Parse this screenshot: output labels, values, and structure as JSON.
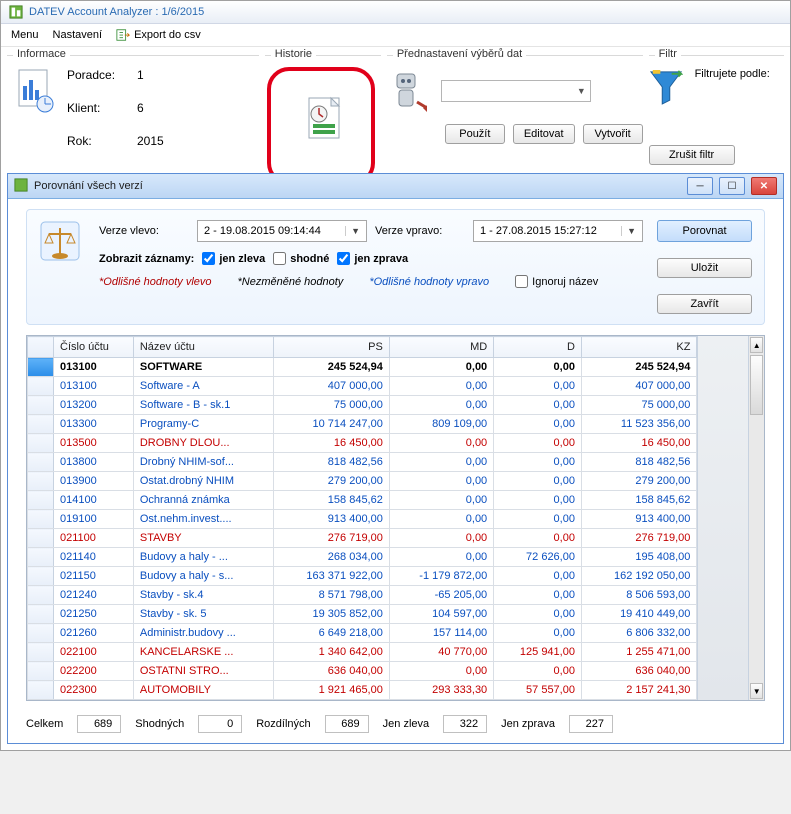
{
  "app": {
    "title": "DATEV Account Analyzer : 1/6/2015"
  },
  "menu": {
    "menu": "Menu",
    "settings": "Nastavení",
    "export": "Export do csv"
  },
  "panels": {
    "informace": {
      "title": "Informace",
      "poradce_lbl": "Poradce:",
      "poradce_val": "1",
      "klient_lbl": "Klient:",
      "klient_val": "6",
      "rok_lbl": "Rok:",
      "rok_val": "2015"
    },
    "historie": {
      "title": "Historie"
    },
    "prednast": {
      "title": "Přednastavení výběrů dat",
      "pouzit": "Použít",
      "editovat": "Editovat",
      "vytvorit": "Vytvořit"
    },
    "filtr": {
      "title": "Filtr",
      "podle": "Filtrujete podle:",
      "zrusit": "Zrušit filtr"
    }
  },
  "compare": {
    "title": "Porovnání všech verzí",
    "verze_vlevo_lbl": "Verze vlevo:",
    "verze_vlevo_val": "2 - 19.08.2015 09:14:44",
    "verze_vpravo_lbl": "Verze vpravo:",
    "verze_vpravo_val": "1 - 27.08.2015 15:27:12",
    "porovnat": "Porovnat",
    "ulozit": "Uložit",
    "zavrit": "Zavřít",
    "zobrazit_lbl": "Zobrazit záznamy:",
    "jen_zleva": "jen zleva",
    "shodne": "shodné",
    "jen_zprava": "jen zprava",
    "legend_left": "*Odlišné hodnoty vlevo",
    "legend_mid": "*Nezměněné hodnoty",
    "legend_right": "*Odlišné hodnoty vpravo",
    "ignoruj": "Ignoruj název"
  },
  "grid": {
    "headers": {
      "cislo": "Číslo účtu",
      "nazev": "Název účtu",
      "ps": "PS",
      "md": "MD",
      "d": "D",
      "kz": "KZ"
    },
    "rows": [
      {
        "c": "013100",
        "n": "SOFTWARE",
        "ps": "245 524,94",
        "md": "0,00",
        "d": "0,00",
        "kz": "245 524,94",
        "cls": "bold",
        "selected": true
      },
      {
        "c": "013100",
        "n": "Software - A",
        "ps": "407 000,00",
        "md": "0,00",
        "d": "0,00",
        "kz": "407 000,00",
        "cls": "blue"
      },
      {
        "c": "013200",
        "n": "Software - B - sk.1",
        "ps": "75 000,00",
        "md": "0,00",
        "d": "0,00",
        "kz": "75 000,00",
        "cls": "blue"
      },
      {
        "c": "013300",
        "n": "Programy-C",
        "ps": "10 714 247,00",
        "md": "809 109,00",
        "d": "0,00",
        "kz": "11 523 356,00",
        "cls": "blue"
      },
      {
        "c": "013500",
        "n": "DROBNY DLOU...",
        "ps": "16 450,00",
        "md": "0,00",
        "d": "0,00",
        "kz": "16 450,00",
        "cls": "red"
      },
      {
        "c": "013800",
        "n": "Drobný NHIM-sof...",
        "ps": "818 482,56",
        "md": "0,00",
        "d": "0,00",
        "kz": "818 482,56",
        "cls": "blue"
      },
      {
        "c": "013900",
        "n": "Ostat.drobný NHIM",
        "ps": "279 200,00",
        "md": "0,00",
        "d": "0,00",
        "kz": "279 200,00",
        "cls": "blue"
      },
      {
        "c": "014100",
        "n": "Ochranná známka",
        "ps": "158 845,62",
        "md": "0,00",
        "d": "0,00",
        "kz": "158 845,62",
        "cls": "blue"
      },
      {
        "c": "019100",
        "n": "Ost.nehm.invest....",
        "ps": "913 400,00",
        "md": "0,00",
        "d": "0,00",
        "kz": "913 400,00",
        "cls": "blue"
      },
      {
        "c": "021100",
        "n": "STAVBY",
        "ps": "276 719,00",
        "md": "0,00",
        "d": "0,00",
        "kz": "276 719,00",
        "cls": "red"
      },
      {
        "c": "021140",
        "n": "Budovy a haly  - ...",
        "ps": "268 034,00",
        "md": "0,00",
        "d": "72 626,00",
        "kz": "195 408,00",
        "cls": "blue"
      },
      {
        "c": "021150",
        "n": "Budovy a haly - s...",
        "ps": "163 371 922,00",
        "md": "-1 179 872,00",
        "d": "0,00",
        "kz": "162 192 050,00",
        "cls": "blue"
      },
      {
        "c": "021240",
        "n": "Stavby  - sk.4",
        "ps": "8 571 798,00",
        "md": "-65 205,00",
        "d": "0,00",
        "kz": "8 506 593,00",
        "cls": "blue"
      },
      {
        "c": "021250",
        "n": "Stavby - sk. 5",
        "ps": "19 305 852,00",
        "md": "104 597,00",
        "d": "0,00",
        "kz": "19 410 449,00",
        "cls": "blue"
      },
      {
        "c": "021260",
        "n": "Administr.budovy ...",
        "ps": "6 649 218,00",
        "md": "157 114,00",
        "d": "0,00",
        "kz": "6 806 332,00",
        "cls": "blue"
      },
      {
        "c": "022100",
        "n": "KANCELARSKE ...",
        "ps": "1 340 642,00",
        "md": "40 770,00",
        "d": "125 941,00",
        "kz": "1 255 471,00",
        "cls": "red"
      },
      {
        "c": "022200",
        "n": "OSTATNI STRO...",
        "ps": "636 040,00",
        "md": "0,00",
        "d": "0,00",
        "kz": "636 040,00",
        "cls": "red"
      },
      {
        "c": "022300",
        "n": "AUTOMOBILY",
        "ps": "1 921 465,00",
        "md": "293 333,30",
        "d": "57 557,00",
        "kz": "2 157 241,30",
        "cls": "red"
      }
    ]
  },
  "footer": {
    "celkem_lbl": "Celkem",
    "celkem_val": "689",
    "shodnych_lbl": "Shodných",
    "shodnych_val": "0",
    "rozdil_lbl": "Rozdílných",
    "rozdil_val": "689",
    "zleva_lbl": "Jen zleva",
    "zleva_val": "322",
    "zprava_lbl": "Jen zprava",
    "zprava_val": "227"
  }
}
